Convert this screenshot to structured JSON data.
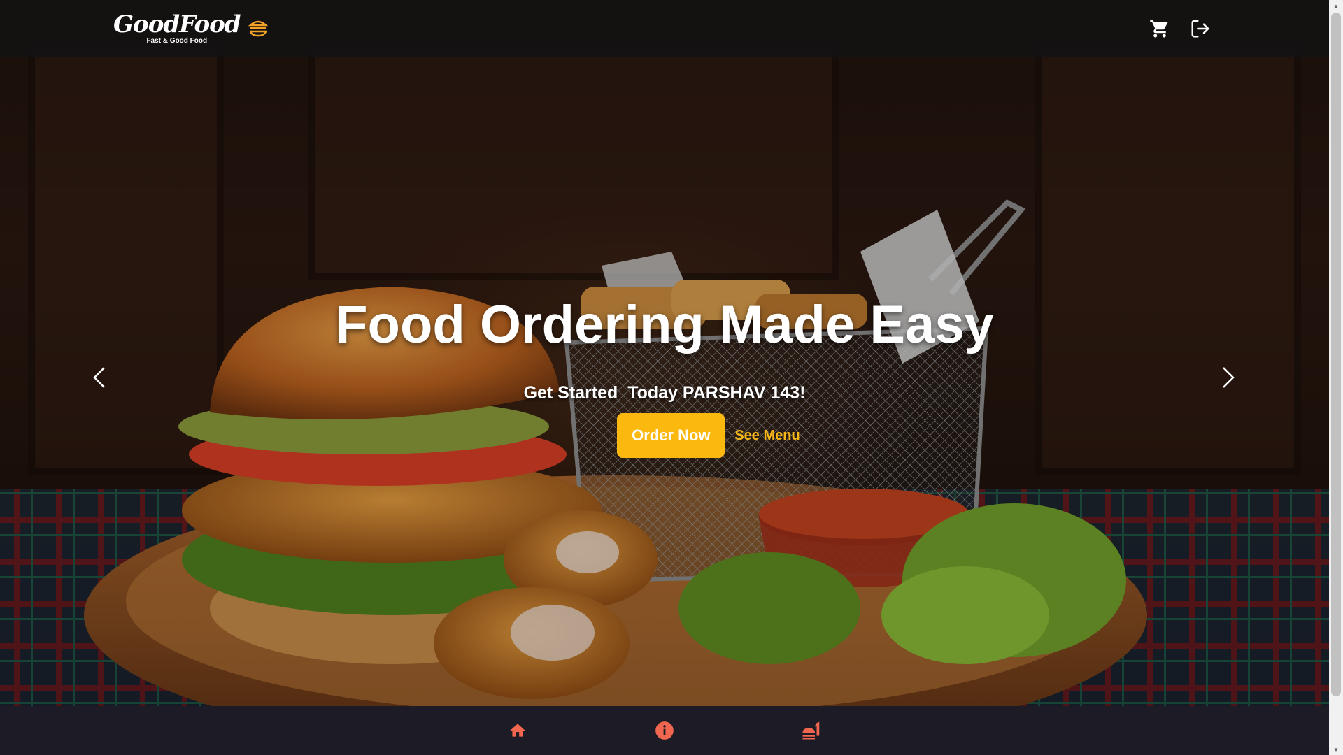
{
  "header": {
    "brand_name": "GoodFood",
    "brand_tagline": "Fast & Good Food",
    "logo_icon": "burger-lines-icon",
    "cart_icon": "cart-icon",
    "logout_icon": "logout-icon"
  },
  "hero": {
    "title": "Food Ordering Made Easy",
    "subtitle": "Get Started  Today PARSHAV 143!",
    "order_button": "Order Now",
    "menu_link": "See Menu",
    "prev_icon": "chevron-left-icon",
    "next_icon": "chevron-right-icon"
  },
  "bottom_nav": {
    "items": [
      {
        "icon": "home-icon"
      },
      {
        "icon": "info-icon"
      },
      {
        "icon": "food-menu-icon"
      }
    ]
  },
  "colors": {
    "accent": "#fbb80e",
    "link": "#f5b618",
    "nav_icon": "#f0664f",
    "nav_bg": "#1d1b26",
    "topbar_bg": "#141212"
  }
}
